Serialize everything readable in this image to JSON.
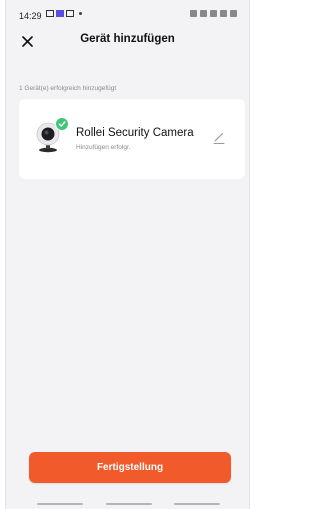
{
  "status_bar": {
    "time": "14:29",
    "left_icons": [
      "image-icon",
      "calendar-icon",
      "media-icon"
    ],
    "right_icons": [
      "mute-icon",
      "wifi-icon",
      "sim-icon",
      "signal-icon",
      "battery-icon"
    ]
  },
  "header": {
    "title": "Gerät hinzufügen",
    "close_icon": "close-icon"
  },
  "info": {
    "text": "1 Gerät(e) erfolgreich hinzugefügt"
  },
  "device": {
    "name": "Rollei Security Camera",
    "status": "Hinzufügen erfolgr.",
    "icon": "camera-icon",
    "badge_icon": "check-icon",
    "edit_icon": "edit-icon"
  },
  "footer": {
    "finish_label": "Fertigstellung"
  },
  "colors": {
    "accent": "#f15a2b",
    "success": "#3cc877",
    "background": "#f3f3f5",
    "card": "#ffffff"
  }
}
